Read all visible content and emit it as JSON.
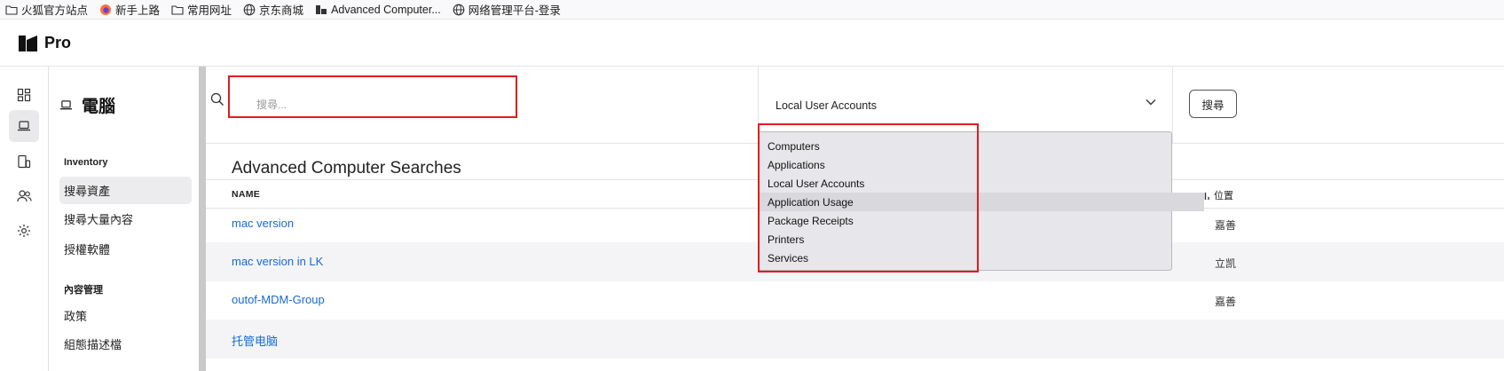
{
  "bookmarks": [
    {
      "label": "火狐官方站点",
      "icon": "folder-icon"
    },
    {
      "label": "新手上路",
      "icon": "firefox-icon"
    },
    {
      "label": "常用网址",
      "icon": "folder-icon"
    },
    {
      "label": "京东商城",
      "icon": "globe-icon"
    },
    {
      "label": "Advanced Computer...",
      "icon": "jamf-icon"
    },
    {
      "label": "网络管理平台-登录",
      "icon": "globe-icon"
    }
  ],
  "app": {
    "brand": "Pro"
  },
  "subnav": {
    "title": "電腦",
    "section_inventory": "Inventory",
    "items_inventory": [
      "搜尋資產",
      "搜尋大量內容",
      "授權軟體"
    ],
    "section_content": "內容管理",
    "items_content": [
      "政策",
      "組態描述檔"
    ]
  },
  "search": {
    "placeholder": "搜尋...",
    "value": ""
  },
  "criteria": {
    "selected": "Local User Accounts",
    "options": [
      "Computers",
      "Applications",
      "Local User Accounts",
      "Application Usage",
      "Package Receipts",
      "Printers",
      "Services"
    ],
    "hovered": "Application Usage"
  },
  "search_button": "搜尋",
  "page_title": "Advanced Computer Searches",
  "table": {
    "col_name": "NAME",
    "col_location": "位置",
    "rows": [
      {
        "name": "mac version",
        "location": "嘉善"
      },
      {
        "name": "mac version in LK",
        "location": "立凯"
      },
      {
        "name": "outof-MDM-Group",
        "location": "嘉善"
      },
      {
        "name": "托管电脑",
        "location": ""
      }
    ]
  },
  "colors": {
    "link": "#1769d2",
    "highlight": "#e41b1b"
  }
}
